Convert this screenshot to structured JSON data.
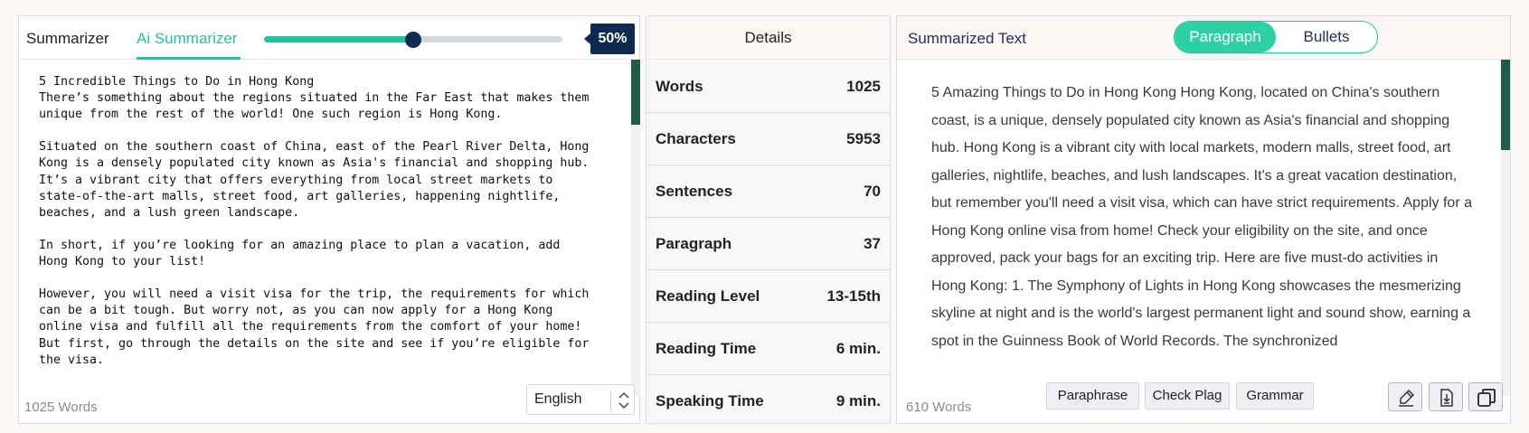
{
  "left": {
    "tabs": [
      "Summarizer",
      "Ai Summarizer"
    ],
    "slider": {
      "value": 50,
      "label": "50%"
    },
    "input_text": "5 Incredible Things to Do in Hong Kong\nThere’s something about the regions situated in the Far East that makes them\nunique from the rest of the world! One such region is Hong Kong.\n\nSituated on the southern coast of China, east of the Pearl River Delta, Hong\nKong is a densely populated city known as Asia's financial and shopping hub.\nIt’s a vibrant city that offers everything from local street markets to\nstate-of-the-art malls, street food, art galleries, happening nightlife,\nbeaches, and a lush green landscape.\n\nIn short, if you’re looking for an amazing place to plan a vacation, add\nHong Kong to your list!\n\nHowever, you will need a visit visa for the trip, the requirements for which\ncan be a bit tough. But worry not, as you can now apply for a Hong Kong\nonline visa and fulfill all the requirements from the comfort of your home!\nBut first, go through the details on the site and see if you’re eligible for\nthe visa.",
    "word_count": "1025 Words",
    "language": "English"
  },
  "details": {
    "title": "Details",
    "rows": [
      {
        "label": "Words",
        "value": "1025"
      },
      {
        "label": "Characters",
        "value": "5953"
      },
      {
        "label": "Sentences",
        "value": "70"
      },
      {
        "label": "Paragraph",
        "value": "37"
      },
      {
        "label": "Reading Level",
        "value": "13-15th"
      },
      {
        "label": "Reading Time",
        "value": "6 min."
      },
      {
        "label": "Speaking Time",
        "value": "9 min."
      }
    ]
  },
  "right": {
    "title": "Summarized Text",
    "toggle": {
      "active": "Paragraph",
      "inactive": "Bullets"
    },
    "output_text": "5 Amazing Things to Do in Hong Kong Hong Kong, located on China's southern coast, is a unique, densely populated city known as Asia's financial and shopping hub. Hong Kong is a vibrant city with local markets, modern malls, street food, art galleries, nightlife, beaches, and lush landscapes. It's a great vacation destination, but remember you'll need a visit visa, which can have strict requirements. Apply for a Hong Kong online visa from home! Check your eligibility on the site, and once approved, pack your bags for an exciting trip. Here are five must-do activities in Hong Kong: 1. The Symphony of Lights in Hong Kong showcases the mesmerizing skyline at night and is the world's largest permanent light and sound show, earning a spot in the Guinness Book of World Records. The synchronized",
    "word_count": "610 Words",
    "buttons": {
      "paraphrase": "Paraphrase",
      "plag": "Check Plag",
      "grammar": "Grammar"
    },
    "icons": [
      "highlighter-icon",
      "download-icon",
      "copy-icon"
    ]
  },
  "colors": {
    "accent": "#27c29c",
    "navy": "#0f2a4f",
    "scroll_thumb": "#1f5a4a"
  }
}
